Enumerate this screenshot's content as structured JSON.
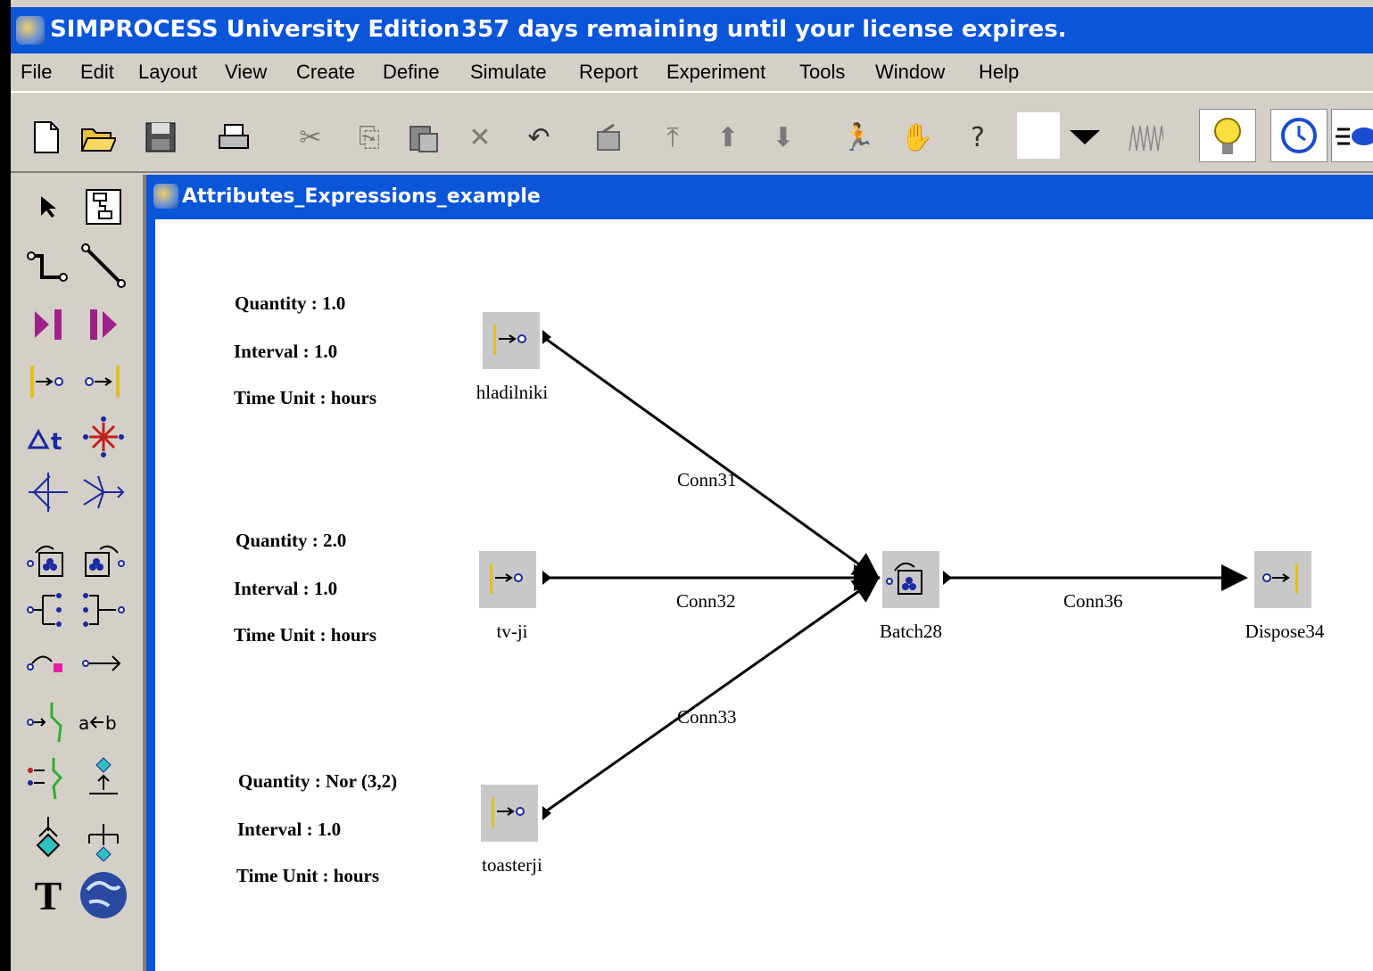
{
  "window": {
    "app_title": "SIMPROCESS University Edition",
    "license_notice": "357 days remaining until your license expires."
  },
  "menu": [
    "File",
    "Edit",
    "Layout",
    "View",
    "Create",
    "Define",
    "Simulate",
    "Report",
    "Experiment",
    "Tools",
    "Window",
    "Help"
  ],
  "toolbar": {
    "icons": [
      "new-icon",
      "open-icon",
      "save-icon",
      "print-icon",
      "cut-icon",
      "copy-icon",
      "paste-icon",
      "delete-icon",
      "undo-icon",
      "properties-icon",
      "move-top-icon",
      "move-up-icon",
      "move-down-icon",
      "run-icon",
      "stop-icon",
      "help-icon",
      "color-swatch",
      "dropdown-icon",
      "trace-icon",
      "bulb-icon",
      "clock-icon",
      "speed-icon"
    ]
  },
  "palette": {
    "icons": [
      "pointer-icon",
      "layout-icon",
      "connector-icon",
      "line-icon",
      "play-icon",
      "pause-icon",
      "generate-icon",
      "dispose-icon",
      "delay-icon",
      "split-icon",
      "branch-icon",
      "merge-icon",
      "batch-icon",
      "unbatch-icon",
      "assemble-icon",
      "disassemble-icon",
      "transform-icon",
      "transfer-icon",
      "gate-icon",
      "assign-icon",
      "synchronize-icon",
      "get-icon",
      "decision-icon",
      "free-icon",
      "text-icon",
      "globe-icon"
    ]
  },
  "model": {
    "title": "Attributes_Expressions_example",
    "generators": [
      {
        "name": "hladilniki",
        "quantity": "Quantity : 1.0",
        "interval": "Interval : 1.0",
        "time_unit": "Time Unit : hours"
      },
      {
        "name": "tv-ji",
        "quantity": "Quantity : 2.0",
        "interval": "Interval : 1.0",
        "time_unit": "Time Unit : hours"
      },
      {
        "name": "toasterji",
        "quantity": "Quantity : Nor (3,2)",
        "interval": "Interval : 1.0",
        "time_unit": "Time Unit : hours"
      }
    ],
    "batch": {
      "name": "Batch28"
    },
    "dispose": {
      "name": "Dispose34"
    },
    "connectors": [
      "Conn31",
      "Conn32",
      "Conn33",
      "Conn36"
    ]
  }
}
